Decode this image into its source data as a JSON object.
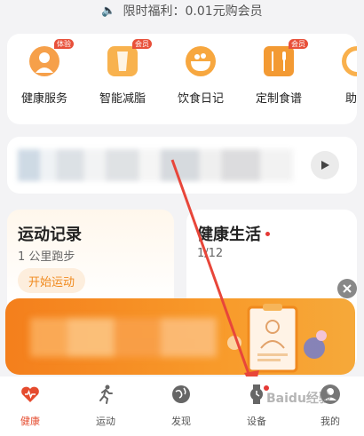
{
  "announcement": {
    "text": "限时福利：0.01元购会员"
  },
  "services": [
    {
      "label": "健康服务",
      "icon": "health-service-icon",
      "tag": "体验"
    },
    {
      "label": "智能减脂",
      "icon": "fat-loss-icon",
      "tag": "会员"
    },
    {
      "label": "饮食日记",
      "icon": "diet-diary-icon",
      "tag": ""
    },
    {
      "label": "定制食谱",
      "icon": "recipe-icon",
      "tag": "会员"
    },
    {
      "label": "助眠",
      "icon": "sleep-aid-icon",
      "tag": ""
    }
  ],
  "exercise_card": {
    "title": "运动记录",
    "subtitle": "1 公里跑步",
    "button": "开始运动"
  },
  "health_card": {
    "title": "健康生活",
    "subtitle": "1/12"
  },
  "tabbar": [
    {
      "label": "健康",
      "icon": "heart-icon",
      "active": true
    },
    {
      "label": "运动",
      "icon": "running-icon",
      "active": false
    },
    {
      "label": "发现",
      "icon": "globe-icon",
      "active": false
    },
    {
      "label": "设备",
      "icon": "watch-icon",
      "active": false
    },
    {
      "label": "我的",
      "icon": "profile-icon",
      "active": false
    }
  ],
  "watermark": "Baidu经验",
  "colors": {
    "accent": "#e54b2e",
    "orange": "#f47f1c",
    "annotation_arrow": "#e8463a"
  }
}
